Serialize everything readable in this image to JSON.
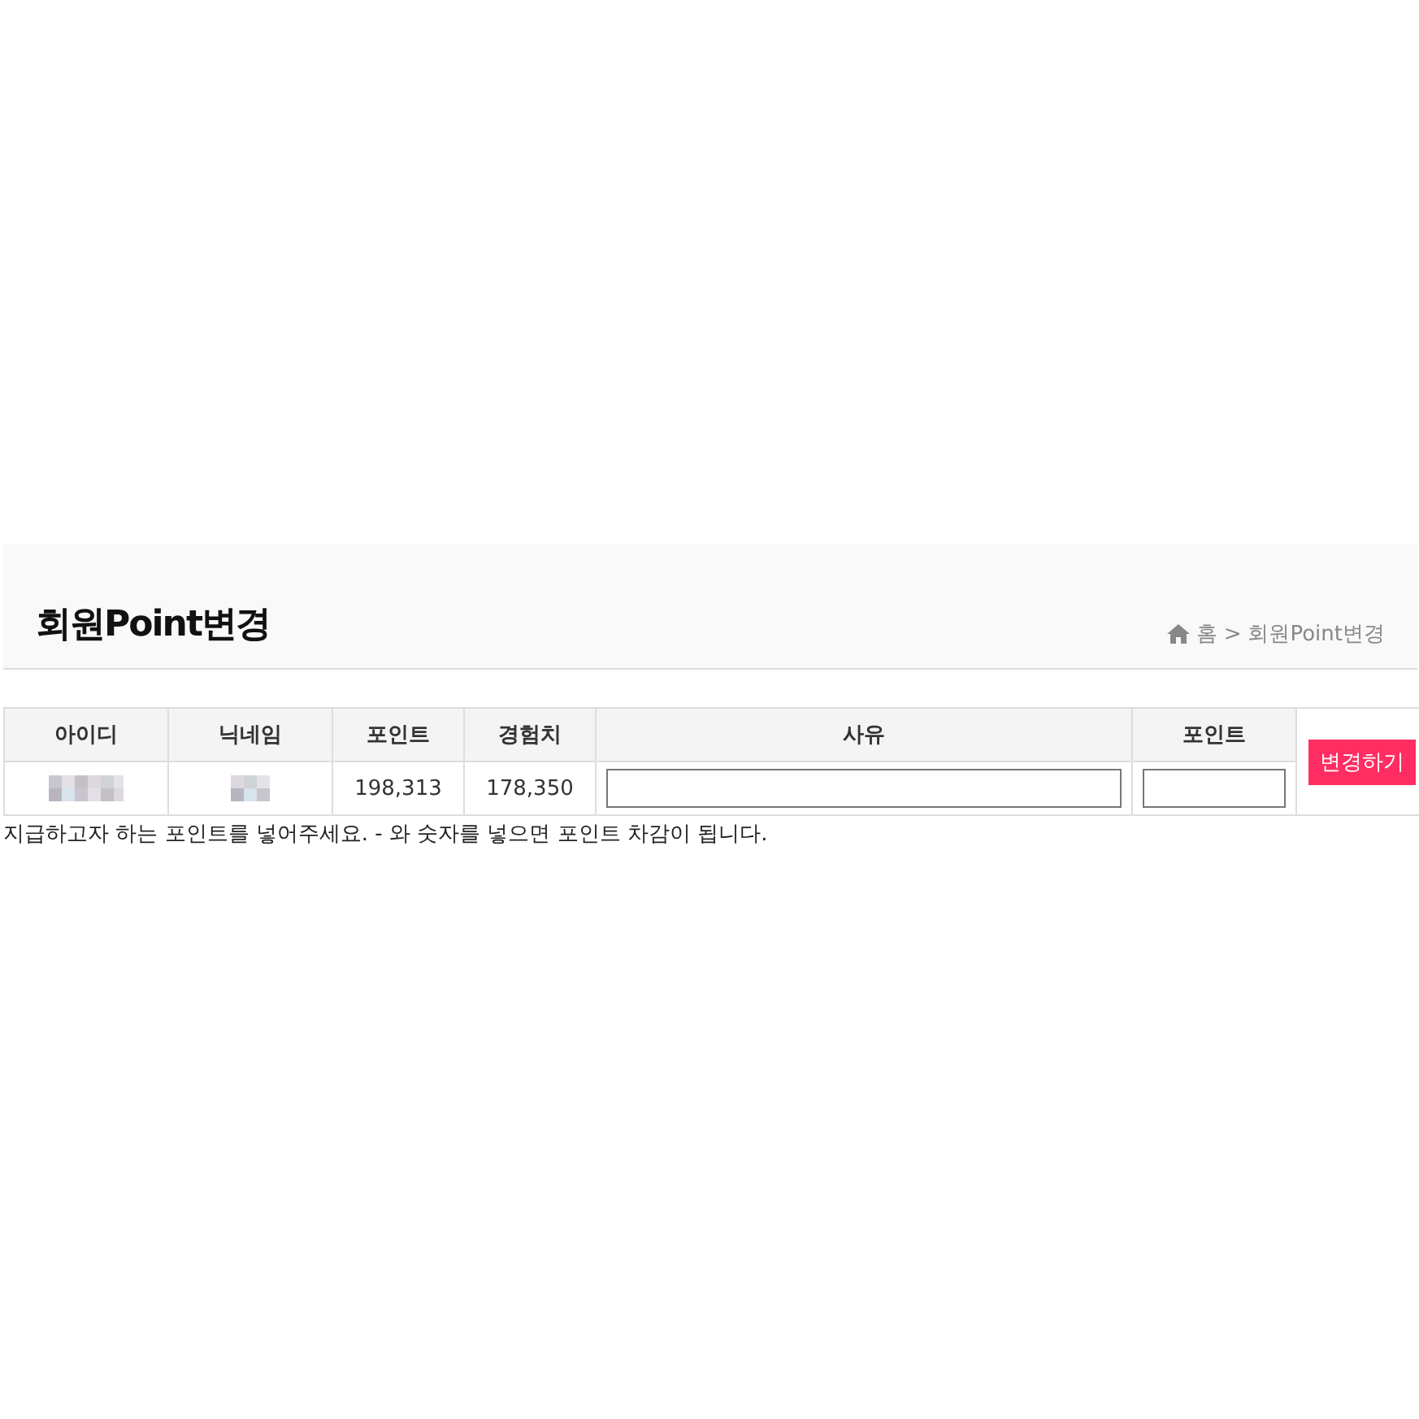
{
  "header": {
    "title": "회원Point변경",
    "breadcrumb": [
      "홈",
      "회원Point변경"
    ],
    "breadcrumb_separator": ">"
  },
  "table": {
    "columns": [
      "아이디",
      "닉네임",
      "포인트",
      "경험치",
      "사유",
      "포인트"
    ],
    "row": [
      {
        "kind": "redacted"
      },
      {
        "kind": "redacted"
      },
      {
        "kind": "text",
        "text": "198,313"
      },
      {
        "kind": "text",
        "text": "178,350"
      },
      {
        "kind": "input"
      },
      {
        "kind": "input"
      }
    ],
    "button": "변경하기"
  },
  "note": "지급하고자 하는 포인트를 넣어주세요. - 와 숫자를 넣으면 포인트 차감이 됩니다."
}
